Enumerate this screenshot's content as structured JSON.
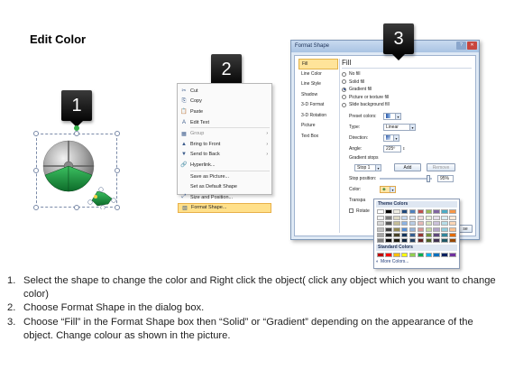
{
  "title": "Edit Color",
  "badges": [
    "1",
    "2",
    "3"
  ],
  "context_menu": {
    "items": [
      {
        "icon": "✂",
        "label": "Cut",
        "arrow": ""
      },
      {
        "icon": "⎘",
        "label": "Copy",
        "arrow": ""
      },
      {
        "icon": "📋",
        "label": "Paste",
        "arrow": ""
      },
      {
        "icon": "A",
        "label": "Edit Text",
        "arrow": ""
      },
      {
        "icon": "▦",
        "label": "Group",
        "arrow": "›"
      },
      {
        "icon": "▲",
        "label": "Bring to Front",
        "arrow": "›"
      },
      {
        "icon": "▼",
        "label": "Send to Back",
        "arrow": "›"
      },
      {
        "icon": "🔗",
        "label": "Hyperlink...",
        "arrow": ""
      },
      {
        "icon": "",
        "label": "Save as Picture...",
        "arrow": ""
      },
      {
        "icon": "",
        "label": "Set as Default Shape",
        "arrow": ""
      },
      {
        "icon": "⤢",
        "label": "Size and Position...",
        "arrow": ""
      },
      {
        "icon": "▧",
        "label": "Format Shape...",
        "arrow": ""
      }
    ]
  },
  "dialog": {
    "title": "Format Shape",
    "title_buttons": [
      "?",
      "✕"
    ],
    "nav": [
      "Fill",
      "Line Color",
      "Line Style",
      "Shadow",
      "3-D Format",
      "3-D Rotation",
      "Picture",
      "Text Box"
    ],
    "section": "Fill",
    "fill_options": [
      {
        "label": "No fill",
        "selected": false
      },
      {
        "label": "Solid fill",
        "selected": false
      },
      {
        "label": "Gradient fill",
        "selected": true
      },
      {
        "label": "Picture or texture fill",
        "selected": false
      },
      {
        "label": "Slide background fill",
        "selected": false
      }
    ],
    "preset_colors_label": "Preset colors:",
    "type_label": "Type:",
    "type_value": "Linear",
    "direction_label": "Direction:",
    "angle_label": "Angle:",
    "angle_value": "225º",
    "gradient_stops_label": "Gradient stops",
    "stop_value": "Stop 1",
    "add_label": "Add",
    "remove_label": "Remove",
    "stop_position_label": "Stop position:",
    "stop_position_value": "95%",
    "color_label": "Color:",
    "transparency_label": "Transpa",
    "rotate_label": "Rotate",
    "close_fragment": "se"
  },
  "color_picker": {
    "theme_header": "Theme Colors",
    "standard_header": "Standard Colors",
    "more_label": "More Colors...",
    "theme_rows": [
      [
        "#ffffff",
        "#000000",
        "#eeece1",
        "#1f497d",
        "#4f81bd",
        "#c0504d",
        "#9bbb59",
        "#8064a2",
        "#4bacc6",
        "#f79646"
      ],
      [
        "#f2f2f2",
        "#7f7f7f",
        "#ddd9c3",
        "#c6d9f0",
        "#dbe5f1",
        "#f2dcdb",
        "#ebf1dd",
        "#e5e0ec",
        "#dbeef3",
        "#fdeada"
      ],
      [
        "#d8d8d8",
        "#595959",
        "#c4bd97",
        "#8db3e2",
        "#b8cce4",
        "#e5b9b7",
        "#d7e3bc",
        "#ccc1d9",
        "#b7dde8",
        "#fbd5b5"
      ],
      [
        "#bfbfbf",
        "#3f3f3f",
        "#938953",
        "#548dd4",
        "#95b3d7",
        "#d99694",
        "#c3d69b",
        "#b2a2c7",
        "#92cddc",
        "#fac08f"
      ],
      [
        "#a5a5a5",
        "#262626",
        "#494429",
        "#17365d",
        "#366092",
        "#953734",
        "#76923c",
        "#5f497a",
        "#31859b",
        "#e36c09"
      ],
      [
        "#7f7f7f",
        "#0c0c0c",
        "#1d1b10",
        "#0f243e",
        "#244061",
        "#632423",
        "#4f6128",
        "#3f3151",
        "#205867",
        "#974806"
      ]
    ],
    "standard_row": [
      "#c00000",
      "#ff0000",
      "#ffc000",
      "#ffff00",
      "#92d050",
      "#00b050",
      "#00b0f0",
      "#0070c0",
      "#002060",
      "#7030a0"
    ]
  },
  "instructions": [
    {
      "num": "1.",
      "text": "Select the shape to change the color and Right click the object( click any object which you want to change color)"
    },
    {
      "num": "2.",
      "text": "Choose Format Shape in the dialog box."
    },
    {
      "num": "3.",
      "text": "Choose “Fill” in the Format Shape box then “Solid” or “Gradient” depending on the appearance of the object. Change colour as shown in the picture."
    }
  ]
}
